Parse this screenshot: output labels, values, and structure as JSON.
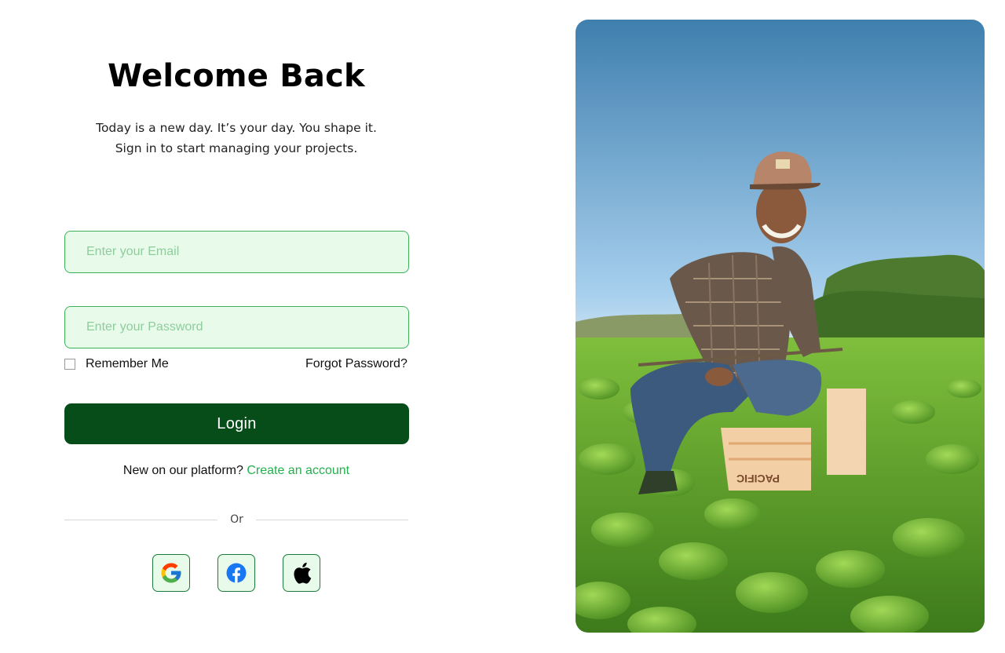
{
  "header": {
    "title": "Welcome Back",
    "subtitle_line1": "Today is a new day. It’s your day. You shape it.",
    "subtitle_line2": "Sign in to start managing your projects."
  },
  "form": {
    "email_placeholder": "Enter your Email",
    "password_placeholder": "Enter your Password",
    "remember_label": "Remember Me",
    "remember_checked": false,
    "forgot_label": "Forgot Password?",
    "login_label": "Login"
  },
  "signup": {
    "prompt": "New on our platform?",
    "link_label": "Create an account"
  },
  "divider": {
    "label": "Or"
  },
  "social": [
    {
      "name": "google",
      "icon": "google-icon"
    },
    {
      "name": "facebook",
      "icon": "facebook-icon"
    },
    {
      "name": "apple",
      "icon": "apple-icon"
    }
  ],
  "hero": {
    "description_icon": "farmer-photo",
    "crate_text": "PACIFIC"
  },
  "colors": {
    "primary_dark_green": "#064d19",
    "accent_green": "#22b14c",
    "input_bg": "#e8fbea",
    "input_border": "#3db15a"
  }
}
